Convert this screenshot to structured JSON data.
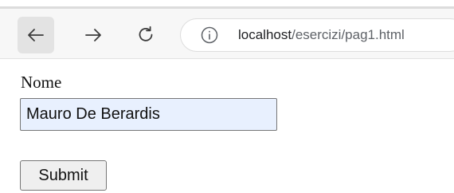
{
  "browser": {
    "url_host": "localhost",
    "url_path": "/esercizi/pag1.html",
    "icons": {
      "back": "back-arrow-icon",
      "forward": "forward-arrow-icon",
      "reload": "reload-icon",
      "info": "info-icon"
    }
  },
  "form": {
    "label": "Nome",
    "input_value": "Mauro De Berardis",
    "submit_label": "Submit"
  },
  "colors": {
    "input_autofill_bg": "#e8f0fe",
    "toolbar_bg": "#f7f7f7"
  }
}
